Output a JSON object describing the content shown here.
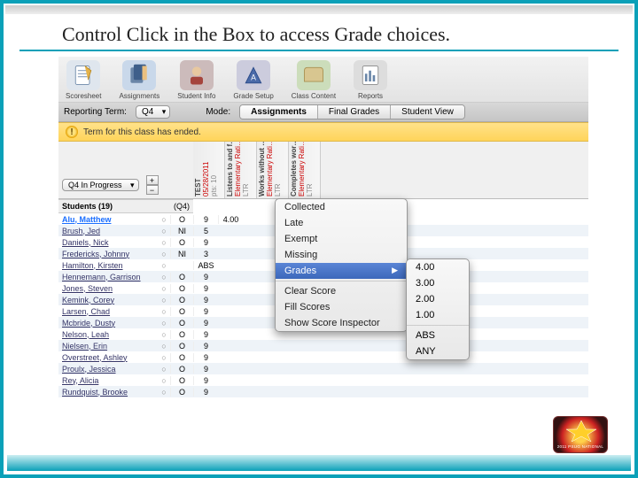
{
  "slide": {
    "title": "Control Click in the Box to access Grade choices."
  },
  "toolbar": {
    "items": [
      {
        "label": "Scoresheet",
        "icon": "scoresheet-icon"
      },
      {
        "label": "Assignments",
        "icon": "assignments-icon"
      },
      {
        "label": "Student Info",
        "icon": "studentinfo-icon"
      },
      {
        "label": "Grade Setup",
        "icon": "gradesetup-icon"
      },
      {
        "label": "Class Content",
        "icon": "classcontent-icon"
      },
      {
        "label": "Reports",
        "icon": "reports-icon"
      }
    ]
  },
  "subbar": {
    "reporting_term_label": "Reporting Term:",
    "reporting_term_value": "Q4",
    "mode_label": "Mode:",
    "modes": [
      "Assignments",
      "Final Grades",
      "Student View"
    ]
  },
  "notice": {
    "text": "Term for this class has ended."
  },
  "corner": {
    "filter_value": "Q4 In Progress",
    "plus": "+",
    "minus": "−"
  },
  "columns": [
    {
      "title": "TEST",
      "date": "05/28/2011",
      "meta": "pts: 10"
    },
    {
      "title": "Listens to and f…",
      "date": "Elementary Rati…",
      "meta": "LTR"
    },
    {
      "title": "Works without …",
      "date": "Elementary Rati…",
      "meta": "LTR"
    },
    {
      "title": "Completes wor…",
      "date": "Elementary Rati…",
      "meta": "LTR"
    }
  ],
  "students_header": {
    "label": "Students (19)",
    "sub": "(Q4)"
  },
  "students": [
    {
      "name": "Alu, Matthew",
      "grade": "O",
      "c1": "9",
      "c2": "4.00",
      "selected": true
    },
    {
      "name": "Brush, Jed",
      "grade": "NI",
      "c1": "5"
    },
    {
      "name": "Daniels, Nick",
      "grade": "O",
      "c1": "9"
    },
    {
      "name": "Fredericks, Johnny",
      "grade": "NI",
      "c1": "3"
    },
    {
      "name": "Hamilton, Kirsten",
      "grade": "",
      "c1": "ABS"
    },
    {
      "name": "Hennemann, Garrison",
      "grade": "O",
      "c1": "9"
    },
    {
      "name": "Jones, Steven",
      "grade": "O",
      "c1": "9"
    },
    {
      "name": "Kemink, Corey",
      "grade": "O",
      "c1": "9"
    },
    {
      "name": "Larsen, Chad",
      "grade": "O",
      "c1": "9"
    },
    {
      "name": "Mcbride, Dusty",
      "grade": "O",
      "c1": "9"
    },
    {
      "name": "Nelson, Leah",
      "grade": "O",
      "c1": "9"
    },
    {
      "name": "Nielsen, Erin",
      "grade": "O",
      "c1": "9"
    },
    {
      "name": "Overstreet, Ashley",
      "grade": "O",
      "c1": "9"
    },
    {
      "name": "Proulx, Jessica",
      "grade": "O",
      "c1": "9"
    },
    {
      "name": "Rey, Alicia",
      "grade": "O",
      "c1": "9"
    },
    {
      "name": "Rundquist, Brooke",
      "grade": "O",
      "c1": "9"
    }
  ],
  "context_menu": {
    "items_top": [
      "Collected",
      "Late",
      "Exempt",
      "Missing"
    ],
    "highlight": "Grades",
    "items_bottom": [
      "Clear Score",
      "Fill Scores",
      "Show Score Inspector"
    ]
  },
  "grades_submenu": {
    "scores": [
      "4.00",
      "3.00",
      "2.00",
      "1.00"
    ],
    "special": [
      "ABS",
      "ANY"
    ]
  },
  "badge": {
    "text": "2011 PSUG NATIONAL"
  }
}
